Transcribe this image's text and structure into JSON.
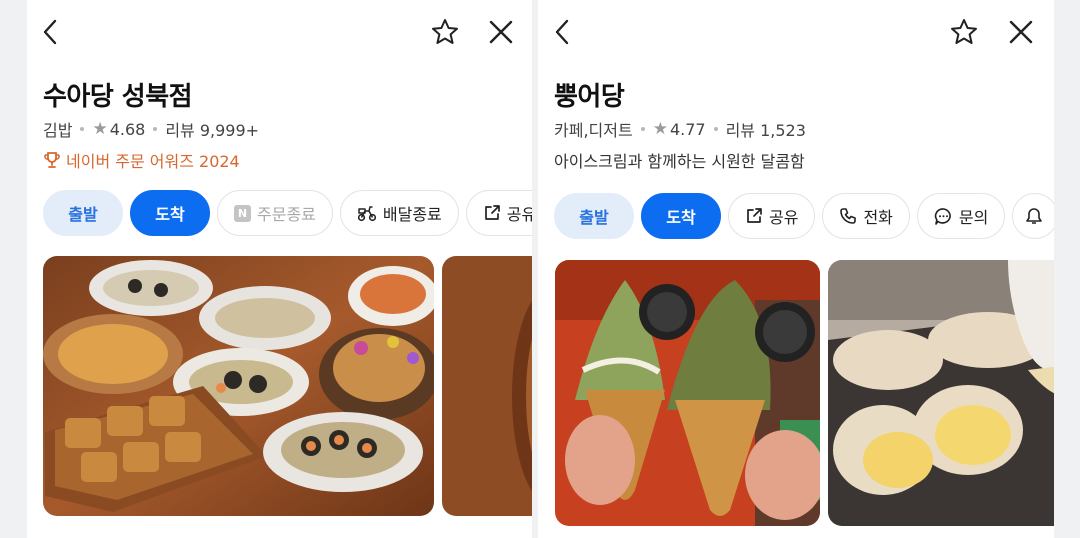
{
  "panels": [
    {
      "title": "수아당 성북점",
      "category": "김밥",
      "rating": "4.68",
      "reviews": "리뷰 9,999+",
      "award": "네이버 주문 어워즈 2024",
      "buttons": {
        "start": "출발",
        "arrive": "도착",
        "order": "주문종료",
        "order_badge": "N",
        "delivery": "배달종료",
        "share": "공유"
      }
    },
    {
      "title": "뿡어당",
      "category": "카페,디저트",
      "rating": "4.77",
      "reviews": "리뷰 1,523",
      "description": "아이스크림과 함께하는 시원한 달콤함",
      "buttons": {
        "start": "출발",
        "arrive": "도착",
        "share": "공유",
        "call": "전화",
        "inquiry": "문의"
      }
    }
  ],
  "icons": [
    "back-icon",
    "star-outline-icon",
    "close-icon",
    "star-icon",
    "trophy-icon",
    "share-icon",
    "phone-icon",
    "chat-icon",
    "bell-icon",
    "scooter-icon"
  ],
  "colors": {
    "primary": "#0d6df0",
    "primary_soft": "#e3edf9",
    "award": "#d8672d",
    "background": "#f0f1f3"
  }
}
